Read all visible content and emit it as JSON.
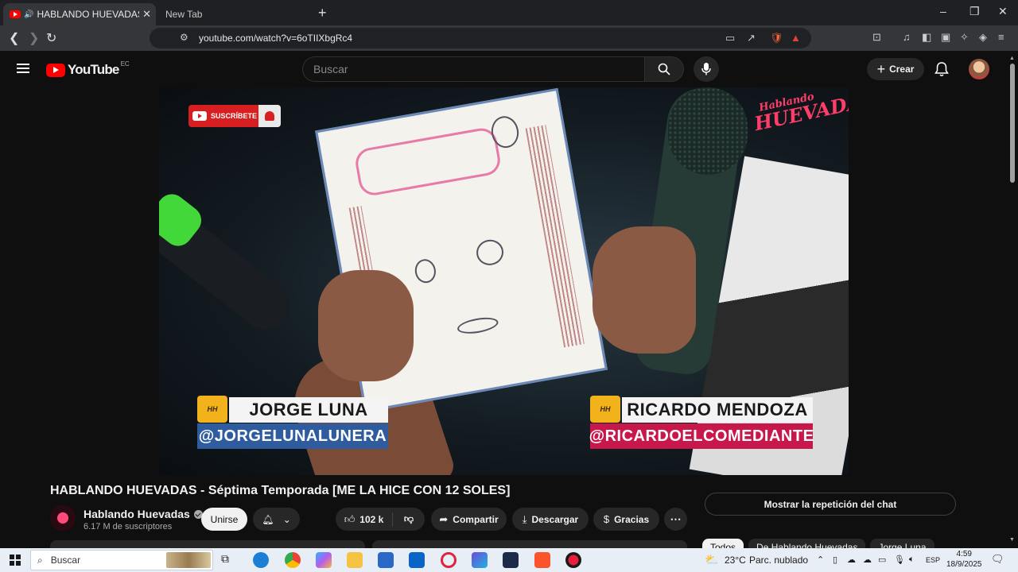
{
  "browser": {
    "tabs": [
      {
        "title": "HABLANDO HUEVADAS - Sép",
        "active": true
      },
      {
        "title": "New Tab",
        "active": false
      }
    ],
    "url": "youtube.com/watch?v=6oTIIXbgRc4"
  },
  "youtube": {
    "logo_text": "YouTube",
    "country_code": "EC",
    "search_placeholder": "Buscar",
    "create_label": "Crear"
  },
  "video": {
    "subscribe_badge": "SUSCRÍBETE",
    "brand_logo_line1": "Hablando",
    "brand_logo_line2": "HUEVADAS",
    "lower_thirds": [
      {
        "badge": "HH",
        "name": "JORGE LUNA",
        "handle": "@JORGELUNALUNERA"
      },
      {
        "badge": "HH",
        "name": "RICARDO MENDOZA",
        "handle": "@RICARDOELCOMEDIANTE"
      }
    ],
    "title": "HABLANDO HUEVADAS - Séptima Temporada [ME LA HICE CON 12 SOLES]"
  },
  "channel": {
    "name": "Hablando Huevadas",
    "subscribers": "6.17 M de suscriptores",
    "join_label": "Unirse"
  },
  "actions": {
    "likes": "102 k",
    "share": "Compartir",
    "download": "Descargar",
    "thanks": "Gracias",
    "chat_replay": "Mostrar la repetición del chat"
  },
  "chips": [
    "Todos",
    "De Hablando Huevadas",
    "Jorge Luna"
  ],
  "taskbar": {
    "search_placeholder": "Buscar",
    "weather_temp": "23°C",
    "weather_desc": "Parc. nublado",
    "language": "ESP",
    "time": "4:59",
    "date": "18/9/2025"
  },
  "colors": {
    "youtube_red": "#ff0000",
    "handle_blue": "#2f5c9e",
    "handle_red": "#c8174a",
    "badge_yellow": "#f2b21c"
  }
}
